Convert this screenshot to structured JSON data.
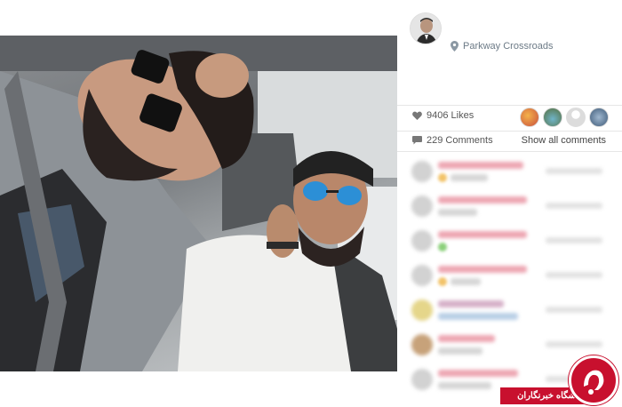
{
  "post": {
    "location": "Parkway Crossroads",
    "likes_count": "9406 Likes",
    "comments_count": "229 Comments",
    "show_all_label": "Show all comments"
  },
  "icons": {
    "location": "map-pin-icon",
    "likes": "heart-icon",
    "comments": "speech-bubble-icon"
  },
  "comments_blurred": true,
  "watermark": {
    "text": "باشگاه خبرنگاران"
  },
  "colors": {
    "brand_red": "#c8102e",
    "meta_text": "#6c7a86",
    "blur_name": "#eda6b2"
  }
}
